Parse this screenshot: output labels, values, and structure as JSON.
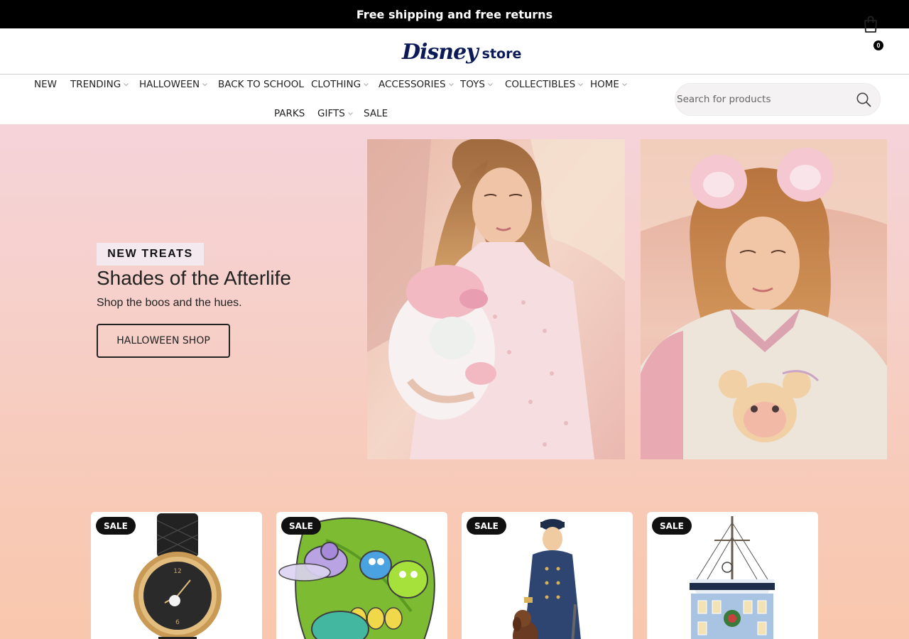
{
  "promo": {
    "text": "Free shipping and free returns"
  },
  "header": {
    "logo_text": "Disney",
    "logo_store": "store",
    "cart_count": "0"
  },
  "nav": {
    "row1": [
      {
        "label": "NEW",
        "has_dropdown": false
      },
      {
        "label": "TRENDING",
        "has_dropdown": true
      },
      {
        "label": "HALLOWEEN",
        "has_dropdown": true
      },
      {
        "label": "BACK TO SCHOOL",
        "has_dropdown": false
      },
      {
        "label": "CLOTHING",
        "has_dropdown": true
      },
      {
        "label": "ACCESSORIES",
        "has_dropdown": true
      },
      {
        "label": "TOYS",
        "has_dropdown": true
      },
      {
        "label": "COLLECTIBLES",
        "has_dropdown": true
      },
      {
        "label": "HOME",
        "has_dropdown": true
      }
    ],
    "row2": [
      {
        "label": "PARKS",
        "has_dropdown": false
      },
      {
        "label": "GIFTS",
        "has_dropdown": true
      },
      {
        "label": "SALE",
        "has_dropdown": false
      }
    ]
  },
  "search": {
    "placeholder": "Search for products",
    "value": ""
  },
  "hero": {
    "tag": "NEW TREATS",
    "title": "Shades of the Afterlife",
    "subtitle": "Shop the boos and the hues.",
    "cta": "HALLOWEEN SHOP"
  },
  "products": [
    {
      "badge": "SALE",
      "icon": "watch"
    },
    {
      "badge": "SALE",
      "icon": "bugs-pin"
    },
    {
      "badge": "SALE",
      "icon": "figurine"
    },
    {
      "badge": "SALE",
      "icon": "ship-ornament"
    }
  ],
  "colors": {
    "promo_bg": "#000000",
    "logo": "#0b1a56",
    "hero_top": "#f5d3d9",
    "hero_bottom": "#f9c7ad",
    "badge_bg": "#111111"
  }
}
